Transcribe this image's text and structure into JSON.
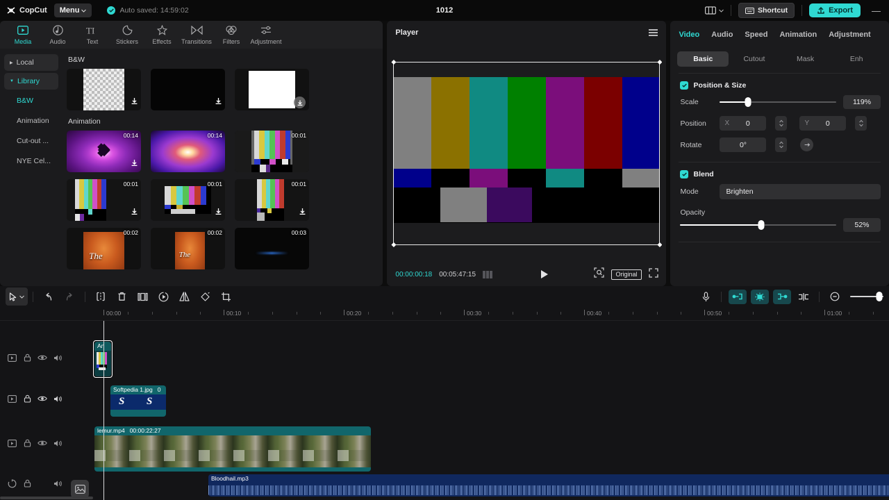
{
  "titlebar": {
    "brand": "CopCut",
    "menu_label": "Menu",
    "autosave_text": "Auto saved: 14:59:02",
    "project_title": "1012",
    "shortcut_label": "Shortcut",
    "export_label": "Export",
    "minimize_label": "—",
    "accent": "#2fd9d2"
  },
  "media_tabs": [
    {
      "label": "Media",
      "icon": "media-icon",
      "active": true
    },
    {
      "label": "Audio",
      "icon": "audio-icon",
      "active": false
    },
    {
      "label": "Text",
      "icon": "text-icon",
      "active": false
    },
    {
      "label": "Stickers",
      "icon": "stickers-icon",
      "active": false
    },
    {
      "label": "Effects",
      "icon": "effects-icon",
      "active": false
    },
    {
      "label": "Transitions",
      "icon": "transitions-icon",
      "active": false
    },
    {
      "label": "Filters",
      "icon": "filters-icon",
      "active": false
    },
    {
      "label": "Adjustment",
      "icon": "adjustment-icon",
      "active": false
    }
  ],
  "library_nav": [
    {
      "label": "Local",
      "type": "group",
      "expanded": false,
      "active": false
    },
    {
      "label": "Library",
      "type": "group",
      "expanded": true,
      "active": true
    },
    {
      "label": "B&W",
      "type": "item",
      "active": true
    },
    {
      "label": "Animation",
      "type": "item",
      "active": false
    },
    {
      "label": "Cut-out ...",
      "type": "item",
      "active": false
    },
    {
      "label": "NYE Cel...",
      "type": "item",
      "active": false
    }
  ],
  "media_sections": [
    {
      "title": "B&W",
      "items": [
        {
          "kind": "transparent",
          "duration": "",
          "download": "small"
        },
        {
          "kind": "black",
          "duration": "",
          "download": "small"
        },
        {
          "kind": "white",
          "duration": "",
          "download": "circle"
        }
      ]
    },
    {
      "title": "Animation",
      "items": [
        {
          "kind": "heart-pink",
          "duration": "00:14",
          "download": "small"
        },
        {
          "kind": "heart-blue",
          "duration": "00:14",
          "download": "none"
        },
        {
          "kind": "bars-a",
          "duration": "00:01",
          "download": "none"
        },
        {
          "kind": "bars-b",
          "duration": "00:01",
          "download": "small"
        },
        {
          "kind": "bars-c",
          "duration": "00:01",
          "download": "small"
        },
        {
          "kind": "bars-d",
          "duration": "00:01",
          "download": "small"
        },
        {
          "kind": "orange-a",
          "duration": "00:02",
          "download": "none"
        },
        {
          "kind": "orange-b",
          "duration": "00:02",
          "download": "none"
        },
        {
          "kind": "dark-c",
          "duration": "00:03",
          "download": "none"
        }
      ]
    }
  ],
  "player": {
    "title": "Player",
    "menu_icon": "hamburger-icon",
    "current_time": "00:00:00:18",
    "total_time": "00:05:47:15",
    "grid_icon": "grid-icon",
    "play_icon": "play-icon",
    "crop_icon": "crop-zoom-icon",
    "quality_label": "Original",
    "fullscreen_icon": "fullscreen-icon",
    "bar_colors": [
      "#808080",
      "#8b7100",
      "#108a82",
      "#008000",
      "#7b0e7b",
      "#7b0000",
      "#00008b"
    ],
    "low_colors": [
      "#00008b",
      "#000000",
      "#7b0e7b",
      "#000000",
      "#108a82",
      "#000000",
      "#808080"
    ],
    "bottom_blocks": [
      {
        "color": "#000000",
        "w": 18
      },
      {
        "color": "#808080",
        "w": 18
      },
      {
        "color": "#3b0a5e",
        "w": 18
      },
      {
        "color": "#000000",
        "w": 46
      }
    ]
  },
  "inspector": {
    "tabs": [
      {
        "label": "Video",
        "active": true
      },
      {
        "label": "Audio",
        "active": false
      },
      {
        "label": "Speed",
        "active": false
      },
      {
        "label": "Animation",
        "active": false
      },
      {
        "label": "Adjustment",
        "active": false
      }
    ],
    "sub_tabs": [
      {
        "label": "Basic",
        "active": true
      },
      {
        "label": "Cutout",
        "active": false
      },
      {
        "label": "Mask",
        "active": false
      },
      {
        "label": "Enh",
        "active": false
      }
    ],
    "position_size": {
      "label": "Position & Size",
      "checked": true,
      "scale_label": "Scale",
      "scale_value": "119%",
      "scale_pct": 24,
      "position_label": "Position",
      "x_axis": "X",
      "x_value": "0",
      "y_axis": "Y",
      "y_value": "0",
      "rotate_label": "Rotate",
      "rotate_value": "0°",
      "reset_icon": "reset-icon"
    },
    "blend": {
      "label": "Blend",
      "checked": true,
      "mode_label": "Mode",
      "mode_value": "Brighten",
      "opacity_label": "Opacity",
      "opacity_value": "52%",
      "opacity_pct": 52
    }
  },
  "timeline": {
    "tools_left": [
      {
        "name": "select-tool",
        "icon": "cursor-icon",
        "state": "selected"
      },
      {
        "name": "undo-button",
        "icon": "undo-icon",
        "state": "normal"
      },
      {
        "name": "redo-button",
        "icon": "redo-icon",
        "state": "disabled"
      },
      {
        "name": "split-button",
        "icon": "split-icon",
        "state": "normal"
      },
      {
        "name": "delete-button",
        "icon": "trash-icon",
        "state": "normal"
      },
      {
        "name": "freeze-button",
        "icon": "freeze-icon",
        "state": "normal"
      },
      {
        "name": "reverse-button",
        "icon": "reverse-icon",
        "state": "normal"
      },
      {
        "name": "mirror-button",
        "icon": "mirror-icon",
        "state": "normal"
      },
      {
        "name": "rotate-button",
        "icon": "rotate-icon",
        "state": "normal"
      },
      {
        "name": "crop-button",
        "icon": "crop-icon",
        "state": "normal"
      }
    ],
    "tools_right": [
      {
        "name": "record-button",
        "icon": "microphone-icon",
        "state": "normal"
      },
      {
        "name": "auto-fill-button",
        "icon": "fill-left-icon",
        "state": "teal"
      },
      {
        "name": "auto-center-button",
        "icon": "fill-center-icon",
        "state": "teal"
      },
      {
        "name": "auto-fill-right-button",
        "icon": "fill-right-icon",
        "state": "teal"
      },
      {
        "name": "split-marker-button",
        "icon": "split-marker-icon",
        "state": "normal"
      },
      {
        "name": "zoom-out-button",
        "icon": "zoom-out-icon",
        "state": "normal"
      }
    ],
    "ruler_labels": [
      "00:00",
      "00:10",
      "00:20",
      "00:30",
      "00:40",
      "00:50",
      "01:00"
    ],
    "playhead_time": "00:00",
    "track_header_icons": [
      "track-type-icon",
      "lock-icon",
      "eye-icon",
      "speaker-icon"
    ],
    "tracks": [
      {
        "type": "video",
        "header_icons": [
          "video-track-icon",
          "lock-icon",
          "eye-icon",
          "speaker-icon"
        ],
        "clips": [
          {
            "label": "An",
            "extra": "",
            "kind": "bars-thumb",
            "selected": true
          }
        ]
      },
      {
        "type": "video",
        "header_icons": [
          "video-track-icon",
          "lock-icon",
          "eye-icon",
          "speaker-icon"
        ],
        "clips": [
          {
            "label": "Softpedia 1.jpg",
            "extra": "0",
            "kind": "softpedia",
            "selected": false
          }
        ]
      },
      {
        "type": "video",
        "header_icons": [
          "video-track-icon",
          "lock-icon",
          "eye-icon",
          "speaker-icon"
        ],
        "clips": [
          {
            "label": "lemur.mp4",
            "extra": "00:00:22:27",
            "kind": "lemur",
            "selected": false
          }
        ],
        "badge_icon": "image-thumbnail-icon"
      },
      {
        "type": "audio",
        "header_icons": [
          "audio-track-icon",
          "lock-icon",
          "speaker-icon"
        ],
        "clips": [
          {
            "label": "Bloodhail.mp3",
            "extra": "",
            "kind": "audio",
            "selected": false
          }
        ]
      }
    ]
  }
}
